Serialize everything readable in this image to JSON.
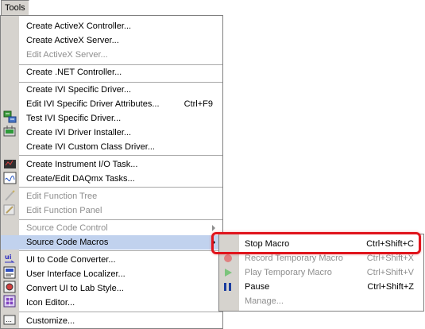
{
  "menubar": {
    "tools_label": "Tools"
  },
  "menu": {
    "items": [
      {
        "label": "Create ActiveX Controller...",
        "shortcut": "",
        "disabled": false
      },
      {
        "label": "Create ActiveX Server...",
        "shortcut": "",
        "disabled": false
      },
      {
        "label": "Edit ActiveX Server...",
        "shortcut": "",
        "disabled": true
      },
      {
        "label": "Create .NET Controller...",
        "shortcut": "",
        "disabled": false
      },
      {
        "label": "Create IVI Specific Driver...",
        "shortcut": "",
        "disabled": false
      },
      {
        "label": "Edit IVI Specific Driver Attributes...",
        "shortcut": "Ctrl+F9",
        "disabled": false
      },
      {
        "label": "Test IVI Specific Driver...",
        "shortcut": "",
        "disabled": false
      },
      {
        "label": "Create IVI Driver Installer...",
        "shortcut": "",
        "disabled": false
      },
      {
        "label": "Create IVI Custom Class Driver...",
        "shortcut": "",
        "disabled": false
      },
      {
        "label": "Create Instrument I/O Task...",
        "shortcut": "",
        "disabled": false
      },
      {
        "label": "Create/Edit DAQmx Tasks...",
        "shortcut": "",
        "disabled": false
      },
      {
        "label": "Edit Function Tree",
        "shortcut": "",
        "disabled": true
      },
      {
        "label": "Edit Function Panel",
        "shortcut": "",
        "disabled": true
      },
      {
        "label": "Source Code Control",
        "shortcut": "",
        "disabled": true
      },
      {
        "label": "Source Code Macros",
        "shortcut": "",
        "disabled": false
      },
      {
        "label": "UI to Code Converter...",
        "shortcut": "",
        "disabled": false
      },
      {
        "label": "User Interface Localizer...",
        "shortcut": "",
        "disabled": false
      },
      {
        "label": "Convert UI to Lab Style...",
        "shortcut": "",
        "disabled": false
      },
      {
        "label": "Icon Editor...",
        "shortcut": "",
        "disabled": false
      },
      {
        "label": "Customize...",
        "shortcut": "",
        "disabled": false
      }
    ]
  },
  "submenu": {
    "items": [
      {
        "label": "Stop Macro",
        "shortcut": "Ctrl+Shift+C",
        "disabled": false
      },
      {
        "label": "Record Temporary Macro",
        "shortcut": "Ctrl+Shift+X",
        "disabled": true
      },
      {
        "label": "Play Temporary Macro",
        "shortcut": "Ctrl+Shift+V",
        "disabled": true
      },
      {
        "label": "Pause",
        "shortcut": "Ctrl+Shift+Z",
        "disabled": false
      },
      {
        "label": "Manage...",
        "shortcut": "",
        "disabled": true
      }
    ]
  },
  "colors": {
    "highlight": "#c1d2ee",
    "gutter": "#d6d3ce",
    "callout": "#e0141c",
    "disabled_text": "#8e8e8e"
  }
}
